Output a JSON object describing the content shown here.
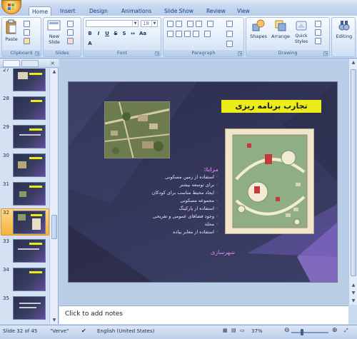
{
  "tabs": [
    "Home",
    "Insert",
    "Design",
    "Animations",
    "Slide Show",
    "Review",
    "View"
  ],
  "ribbon": {
    "clipboard": {
      "paste_label": "Paste",
      "group_label": "Clipboard"
    },
    "slides": {
      "new_slide_label": "New Slide",
      "group_label": "Slides"
    },
    "font": {
      "font_name": "",
      "font_size": "18",
      "group_label": "Font"
    },
    "paragraph": {
      "group_label": "Paragraph"
    },
    "drawing": {
      "shapes_label": "Shapes",
      "arrange_label": "Arrange",
      "quick_styles_label": "Quick Styles",
      "group_label": "Drawing"
    },
    "editing": {
      "label": "Editing"
    }
  },
  "slides_pane": {
    "items": [
      {
        "num": "27"
      },
      {
        "num": "28"
      },
      {
        "num": "29"
      },
      {
        "num": "30"
      },
      {
        "num": "31"
      },
      {
        "num": "32",
        "active": true
      },
      {
        "num": "33"
      },
      {
        "num": "34"
      },
      {
        "num": "35"
      }
    ]
  },
  "slide": {
    "title": "تجارب برنامه ریزی",
    "bullet_head": "مزایا:",
    "bullets": [
      "استفاده از زمین مسکونی",
      "برای توسعه بیشتر",
      "ایجاد محیط مناسب برای کودکان",
      "مجموعه مسکونی",
      "استفاده از پارکینگ",
      "وجود فضاهای عمومی و تفریحی",
      "محله",
      "استفاده از معابر پیاده"
    ],
    "caption": "شهرسازی"
  },
  "notes": {
    "placeholder": "Click to add notes"
  },
  "status": {
    "slide_info": "Slide 32 of 45",
    "theme": "\"Verve\"",
    "language": "English (United States)",
    "zoom": "37%"
  },
  "colors": {
    "title_bg": "#ecec19",
    "accent": "#c870e0",
    "active_thumb": "#f5b13d"
  }
}
